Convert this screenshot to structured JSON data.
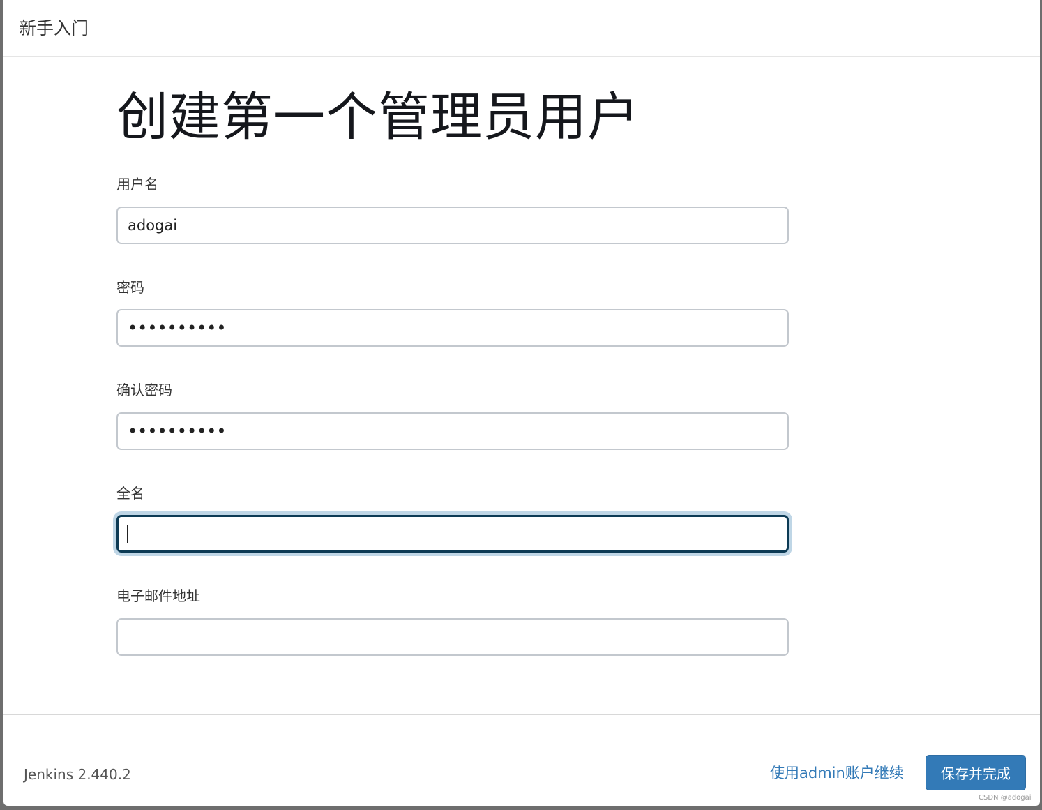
{
  "header": {
    "title": "新手入门"
  },
  "main": {
    "title": "创建第一个管理员用户",
    "fields": [
      {
        "label": "用户名",
        "value": "adogai",
        "type": "text"
      },
      {
        "label": "密码",
        "value": "••••••••••",
        "type": "password"
      },
      {
        "label": "确认密码",
        "value": "••••••••••",
        "type": "password"
      },
      {
        "label": "全名",
        "value": "",
        "type": "text",
        "focused": true
      },
      {
        "label": "电子邮件地址",
        "value": "",
        "type": "text"
      }
    ]
  },
  "footer": {
    "version": "Jenkins 2.440.2",
    "skip_label": "使用admin账户继续",
    "save_label": "保存并完成"
  },
  "watermark": "CSDN @adogai",
  "colors": {
    "accent": "#337ab7",
    "focus_border": "#0d3b55",
    "focus_glow": "#bfd6e6",
    "input_border": "#c3c8ce"
  }
}
